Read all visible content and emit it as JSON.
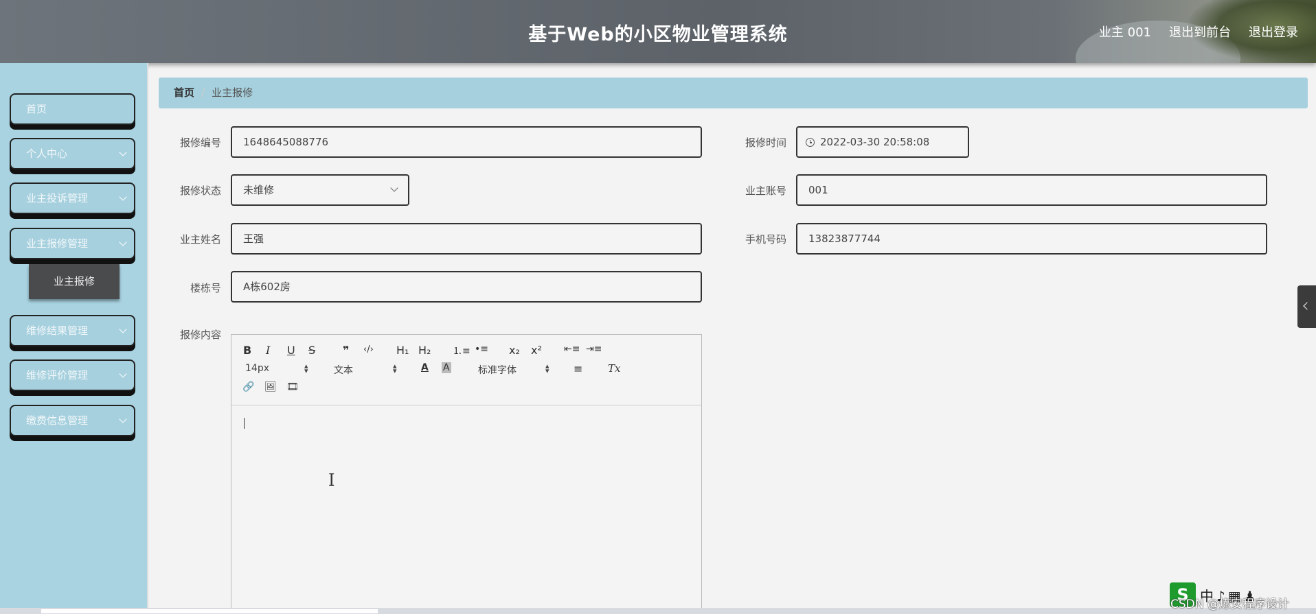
{
  "header": {
    "title": "基于Web的小区物业管理系统",
    "user": "业主 001",
    "back_to_front": "退出到前台",
    "logout": "退出登录"
  },
  "sidebar": {
    "items": [
      {
        "label": "首页"
      },
      {
        "label": "个人中心"
      },
      {
        "label": "业主投诉管理"
      },
      {
        "label": "业主报修管理"
      },
      {
        "label": "维修结果管理"
      },
      {
        "label": "维修评价管理"
      },
      {
        "label": "缴费信息管理"
      }
    ],
    "active_sub": "业主报修"
  },
  "breadcrumb": {
    "home": "首页",
    "separator": "/",
    "current": "业主报修"
  },
  "form": {
    "repair_no": {
      "label": "报修编号",
      "value": "1648645088776"
    },
    "repair_time": {
      "label": "报修时间",
      "value": "2022-03-30 20:58:08"
    },
    "repair_status": {
      "label": "报修状态",
      "value": "未维修"
    },
    "owner_account": {
      "label": "业主账号",
      "value": "001"
    },
    "owner_name": {
      "label": "业主姓名",
      "value": "王强"
    },
    "phone": {
      "label": "手机号码",
      "value": "13823877744"
    },
    "building": {
      "label": "楼栋号",
      "value": "A栋602房"
    },
    "content": {
      "label": "报修内容",
      "value": ""
    }
  },
  "editor": {
    "toolbar": {
      "bold": "B",
      "italic": "I",
      "underline": "U",
      "strike": "S",
      "quote": "❞",
      "code": "‹/›",
      "h1": "H₁",
      "h2": "H₂",
      "ordered": "⒈≡",
      "bullet": "•≡",
      "sub": "x₂",
      "sup": "x²",
      "outdent": "⇤≡",
      "indent": "⇥≡",
      "size": "14px",
      "header_select": "文本",
      "font_color": "A",
      "bg_color": "A",
      "font": "标准字体",
      "align": "≡",
      "clean": "Tx",
      "link": "🔗",
      "image": "🖼",
      "video": "🎞"
    }
  },
  "watermark": "CSDN @炼安程序设计"
}
